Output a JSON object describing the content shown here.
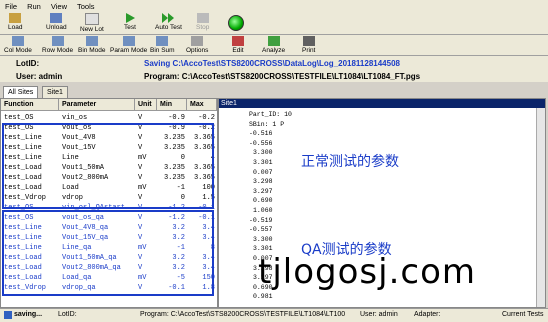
{
  "menu": [
    "File",
    "Run",
    "View",
    "Tools"
  ],
  "toolbar1": [
    "Load",
    "Unload",
    "New Lot",
    "Test",
    "Auto Test",
    "Stop"
  ],
  "toolbar2": [
    "Col Mode",
    "Row Mode",
    "Bin Mode",
    "Param Mode",
    "Bin Sum",
    "Options",
    "Edit",
    "Analyze",
    "Print"
  ],
  "info": {
    "lotid_label": "LotID:",
    "saving": "Saving C:\\AccoTest\\STS8200CROSS\\DataLog\\Log_20181128144508",
    "user": "User: admin",
    "program": "Program: C:\\AccoTest\\STS8200CROSS\\TESTFILE\\LT1084\\LT1084_FT.pgs"
  },
  "tabs": [
    "All Sites",
    "Site1"
  ],
  "columns": [
    "Function",
    "Parameter",
    "Unit",
    "Min",
    "Max"
  ],
  "rows": [
    [
      "test_OS",
      "vin_os",
      "V",
      "-0.9",
      "-0.2"
    ],
    [
      "test_OS",
      "vout_os",
      "V",
      "-0.9",
      "-0.2"
    ],
    [
      "test_Line",
      "Vout_4V8",
      "V",
      "3.235",
      "3.365"
    ],
    [
      "test_Line",
      "Vout_15V",
      "V",
      "3.235",
      "3.365"
    ],
    [
      "test_Line",
      "Line",
      "mV",
      "0",
      "4"
    ],
    [
      "test_Load",
      "Vout1_50mA",
      "V",
      "3.235",
      "3.365"
    ],
    [
      "test_Load",
      "Vout2_800mA",
      "V",
      "3.235",
      "3.365"
    ],
    [
      "test_Load",
      "Load",
      "mV",
      "-1",
      "100"
    ],
    [
      "test_Vdrop",
      "vdrop",
      "V",
      "0",
      "1.5"
    ],
    [
      "test_OS",
      "vin_osl_QAstart",
      "V",
      "-1.2",
      "-0.1"
    ],
    [
      "test_OS",
      "vout_os_qa",
      "V",
      "-1.2",
      "-0.1"
    ],
    [
      "test_Line",
      "Vout_4V8_qa",
      "V",
      "3.2",
      "3.4"
    ],
    [
      "test_Line",
      "Vout_15V_qa",
      "V",
      "3.2",
      "3.4"
    ],
    [
      "test_Line",
      "Line_qa",
      "mV",
      "-1",
      "8"
    ],
    [
      "test_Load",
      "Vout1_50mA_qa",
      "V",
      "3.2",
      "3.4"
    ],
    [
      "test_Load",
      "Vout2_800mA_qa",
      "V",
      "3.2",
      "3.4"
    ],
    [
      "test_Load",
      "Load_qa",
      "mV",
      "-5",
      "150"
    ],
    [
      "test_Vdrop",
      "vdrop_qa",
      "V",
      "-0.1",
      "1.8"
    ]
  ],
  "site_header": "Site1",
  "site_lines": [
    "Part_ID: 10",
    "SBin: 1    P",
    "-0.516",
    "-0.556",
    "3.300",
    "3.301",
    "0.007",
    "3.298",
    "3.297",
    "0.690",
    "1.060",
    "-0.519",
    "-0.557",
    "3.300",
    "3.301",
    "0.007",
    "3.298",
    "3.297",
    "0.690",
    "0.981"
  ],
  "notes": {
    "normal": "正常测试的参数",
    "qa": "QA测试的参数"
  },
  "status": [
    "saving...",
    "LotID:",
    "Program: C:\\AccoTest\\STS8200CROSS\\TESTFILE\\LT1084\\LT100",
    "User: admin",
    "Adapter:",
    "Current Tests"
  ],
  "watermark": "tjlogosj.com",
  "colors": {
    "box": "#1a3cc8",
    "header": "#0a246a"
  }
}
